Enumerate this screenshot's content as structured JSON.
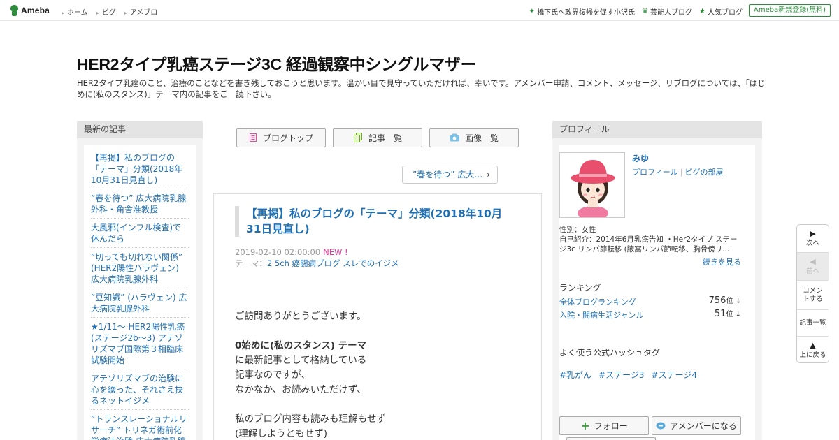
{
  "topbar": {
    "logo_text": "Ameba",
    "nav": [
      "ホーム",
      "ピグ",
      "アメブロ"
    ],
    "right_links": [
      {
        "icon": "sparkle-icon",
        "label": "橋下氏へ政界復帰を促す小沢氏"
      },
      {
        "icon": "crown-icon",
        "label": "芸能人ブログ"
      },
      {
        "icon": "star-icon",
        "label": "人気ブログ"
      }
    ],
    "signup": "Ameba新規登録(無料)"
  },
  "blog": {
    "title": "HER2タイプ乳癌ステージ3C 経過観察中シングルマザー",
    "description": "HER2タイプ乳癌のこと、治療のことなどを書き残しておこうと思います。温かい目で見守っていただければ、幸いです。アメンバー申請、コメント、メッセージ、リブログについては、「はじめに(私のスタンス)」テーマ内の記事をご一読下さい。"
  },
  "left_sidebar": {
    "heading": "最新の記事",
    "items": [
      "【再掲】私のブログの「テーマ」分類(2018年10月31日見直し)",
      "”春を待つ” 広大病院乳腺外科・角舎准教授",
      "大風邪(インフル検査)で休んだら",
      "”切っても切れない関係” (HER2陽性ハラヴェン) 広大病院乳腺外科",
      "”豆知識” (ハラヴェン) 広大病院乳腺外科",
      "★1/11～ HER2陽性乳癌 (ステージ2b～3) アテゾリズマブ国際第３相臨床試験開始",
      "アテゾリズマブの治験に心を綴った、それさえ抉るネットイジメ",
      "”トランスレーショナルリサーチ” トリネガ術前化学療法治験 広大病院乳腺外科 角舎准教授"
    ]
  },
  "center": {
    "nav_buttons": [
      {
        "icon": "document-icon",
        "label": "ブログトップ"
      },
      {
        "icon": "copy-icon",
        "label": "記事一覧"
      },
      {
        "icon": "camera-icon",
        "label": "画像一覧"
      }
    ],
    "pager": "”春を待つ” 広大…",
    "article": {
      "title": "【再掲】私のブログの「テーマ」分類(2018年10月31日見直し)",
      "date": "2019-02-10 02:00:00",
      "new_badge": "NEW !",
      "theme_label": "テーマ：",
      "theme": "2 5ch 癌闘病ブログ スレでのイジメ",
      "body": {
        "line1": "ご訪問ありがとうございます。",
        "line2": "0始めに(私のスタンス) テーマ",
        "line3": "に最新記事として格納している",
        "line4": "記事なのですが、",
        "line5": "なかなか、お読みいただけず、",
        "line6": "私のブログ内容も読みも理解もせず",
        "line7": "(理解しようともせず)"
      }
    }
  },
  "right_sidebar": {
    "heading": "プロフィール",
    "name": "みゆ",
    "profile_link": "プロフィール",
    "pig_link": "ピグの部屋",
    "gender": "性別：女性",
    "intro": "自己紹介：2014年6月乳癌告知 ・Her2タイプ ステージ3c リンパ節転移 (腋窩リンパ節転移、胸骨傍リ...",
    "more": "続きを見る",
    "ranking_heading": "ランキング",
    "rankings": [
      {
        "label": "全体ブログランキング",
        "rank": "756",
        "unit": "位 ↓"
      },
      {
        "label": "入院・闘病生活ジャンル",
        "rank": "51",
        "unit": "位 ↓"
      }
    ],
    "hashtag_heading": "よく使う公式ハッシュタグ",
    "hashtags": [
      "#乳がん",
      "#ステージ3",
      "#ステージ4"
    ],
    "follow": "フォロー",
    "amember": "アメンバーになる"
  },
  "side_nav": {
    "next": "次へ",
    "prev": "前へ",
    "comment": "コメントする",
    "list": "記事一覧",
    "top": "上に戻る"
  }
}
